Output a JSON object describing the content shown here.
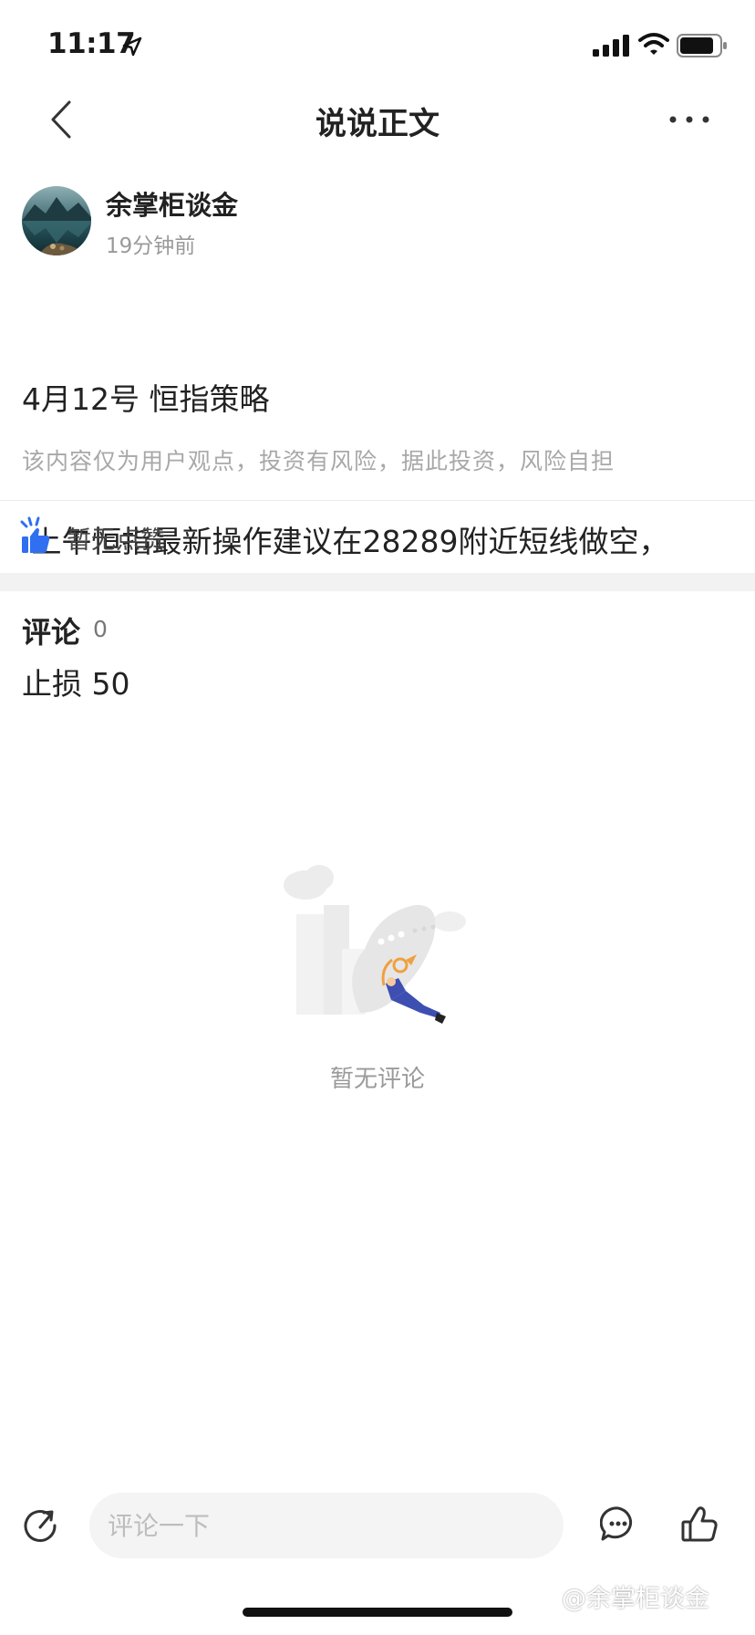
{
  "status_bar": {
    "time": "11:17"
  },
  "nav": {
    "title": "说说正文"
  },
  "post": {
    "author": "余掌柜谈金",
    "time": "19分钟前",
    "lines": [
      "4月12号 恒指策略",
      " 上午恒指最新操作建议在28289附近短线做空，",
      "止损 50"
    ],
    "disclaimer": "该内容仅为用户观点，投资有风险，据此投资，风险自担"
  },
  "likes": {
    "status": "暂无点赞"
  },
  "comments": {
    "heading": "评论",
    "count": "0",
    "empty_text": "暂无评论"
  },
  "bottom_bar": {
    "input_placeholder": "评论一下"
  },
  "watermark": {
    "text": "@余掌柜谈金"
  },
  "colors": {
    "like_blue": "#2f6ff0",
    "accent_orange": "#f0a040"
  }
}
